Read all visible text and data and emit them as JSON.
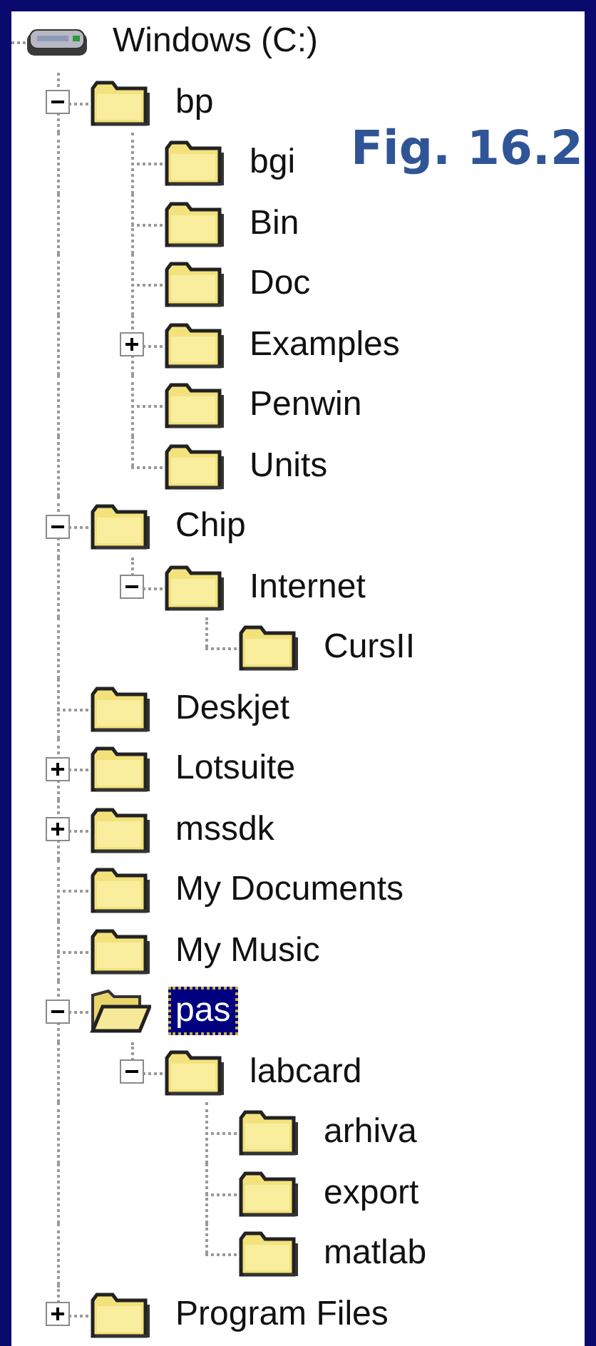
{
  "figure_label": "Fig. 16.2",
  "tree": {
    "label": "Windows (C:)",
    "kind": "drive",
    "selected": false,
    "children": [
      {
        "label": "bp",
        "kind": "folder",
        "selected": false,
        "expanded": true,
        "children": [
          {
            "label": "bgi",
            "kind": "folder",
            "selected": false
          },
          {
            "label": "Bin",
            "kind": "folder",
            "selected": false
          },
          {
            "label": "Doc",
            "kind": "folder",
            "selected": false
          },
          {
            "label": "Examples",
            "kind": "folder",
            "selected": false,
            "expanded": false
          },
          {
            "label": "Penwin",
            "kind": "folder",
            "selected": false
          },
          {
            "label": "Units",
            "kind": "folder",
            "selected": false
          }
        ]
      },
      {
        "label": "Chip",
        "kind": "folder",
        "selected": false,
        "expanded": true,
        "children": [
          {
            "label": "Internet",
            "kind": "folder",
            "selected": false,
            "expanded": true,
            "children": [
              {
                "label": "CursII",
                "kind": "folder",
                "selected": false
              }
            ]
          }
        ]
      },
      {
        "label": "Deskjet",
        "kind": "folder",
        "selected": false
      },
      {
        "label": "Lotsuite",
        "kind": "folder",
        "selected": false,
        "expanded": false
      },
      {
        "label": "mssdk",
        "kind": "folder",
        "selected": false,
        "expanded": false
      },
      {
        "label": "My Documents",
        "kind": "folder",
        "selected": false
      },
      {
        "label": "My Music",
        "kind": "folder",
        "selected": false
      },
      {
        "label": "pas",
        "kind": "folder",
        "selected": true,
        "expanded": true,
        "children": [
          {
            "label": "labcard",
            "kind": "folder",
            "selected": false,
            "expanded": true,
            "children": [
              {
                "label": "arhiva",
                "kind": "folder",
                "selected": false
              },
              {
                "label": "export",
                "kind": "folder",
                "selected": false
              },
              {
                "label": "matlab",
                "kind": "folder",
                "selected": false
              }
            ]
          }
        ]
      },
      {
        "label": "Program Files",
        "kind": "folder",
        "selected": false,
        "expanded": false
      }
    ]
  }
}
